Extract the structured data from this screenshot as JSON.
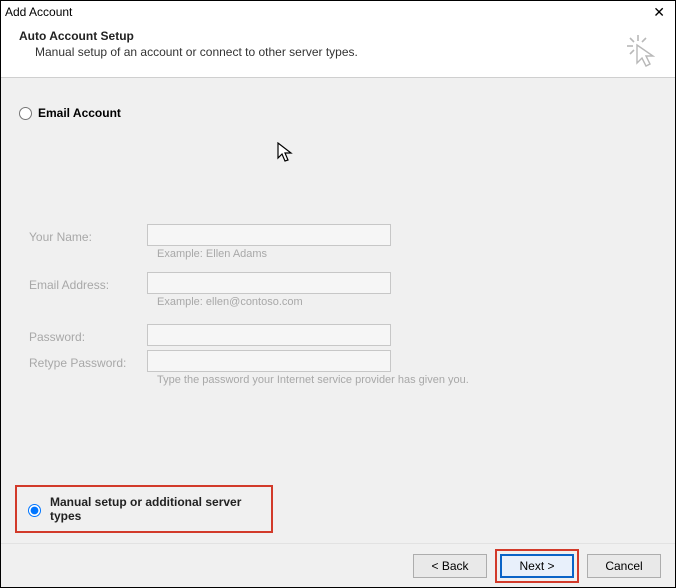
{
  "window": {
    "title": "Add Account"
  },
  "header": {
    "title": "Auto Account Setup",
    "subtitle": "Manual setup of an account or connect to other server types."
  },
  "options": {
    "email_account": {
      "label": "Email Account",
      "selected": false
    },
    "manual_setup": {
      "label": "Manual setup or additional server types",
      "selected": true
    }
  },
  "form": {
    "your_name": {
      "label": "Your Name:",
      "value": "",
      "hint": "Example: Ellen Adams"
    },
    "email": {
      "label": "Email Address:",
      "value": "",
      "hint": "Example: ellen@contoso.com"
    },
    "password": {
      "label": "Password:",
      "value": ""
    },
    "retype_password": {
      "label": "Retype Password:",
      "value": "",
      "hint": "Type the password your Internet service provider has given you."
    }
  },
  "buttons": {
    "back": "< Back",
    "next": "Next >",
    "cancel": "Cancel"
  },
  "icons": {
    "close": "✕"
  }
}
